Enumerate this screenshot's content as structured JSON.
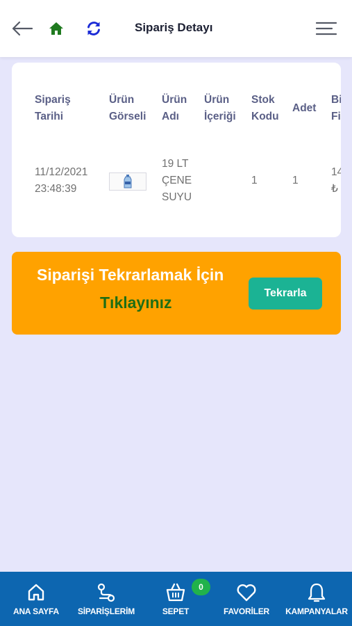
{
  "header": {
    "title": "Sipariş Detayı",
    "back_icon": "arrow-left-icon",
    "home_icon": "home-icon",
    "refresh_icon": "refresh-icon",
    "menu_icon": "hamburger-menu-icon",
    "home_color": "#1f7a1f",
    "refresh_color": "#1b2bd6"
  },
  "table": {
    "columns": [
      "Sipariş\nTarihi",
      "Ürün\nGörseli",
      "Ürün\nAdı",
      "Ürün\nİçeriği",
      "Stok\nKodu",
      "Adet",
      "Bi\nFi"
    ],
    "row": {
      "date": "11/12/2021\n23:48:39",
      "image": "water-bottle-thumbnail",
      "name": "19 LT\nÇENE\nSUYU",
      "content": "",
      "stock_code": "1",
      "quantity": "1",
      "unit_price": "14\n₺"
    }
  },
  "banner": {
    "line1": "Siparişi Tekrarlamak İçin",
    "line2": "Tıklayınız",
    "button": "Tekrarla",
    "bg_color": "#ffa200",
    "button_color": "#1bb394"
  },
  "bottom_nav": {
    "bg_color": "#0d66b0",
    "cart_count": "0",
    "items": [
      {
        "label": "ANA SAYFA",
        "icon": "home-outline-icon"
      },
      {
        "label": "SİPARİŞLERİM",
        "icon": "route-icon"
      },
      {
        "label": "SEPET",
        "icon": "basket-icon"
      },
      {
        "label": "FAVORİLER",
        "icon": "heart-icon"
      },
      {
        "label": "KAMPANYALAR",
        "icon": "bell-icon"
      }
    ]
  }
}
